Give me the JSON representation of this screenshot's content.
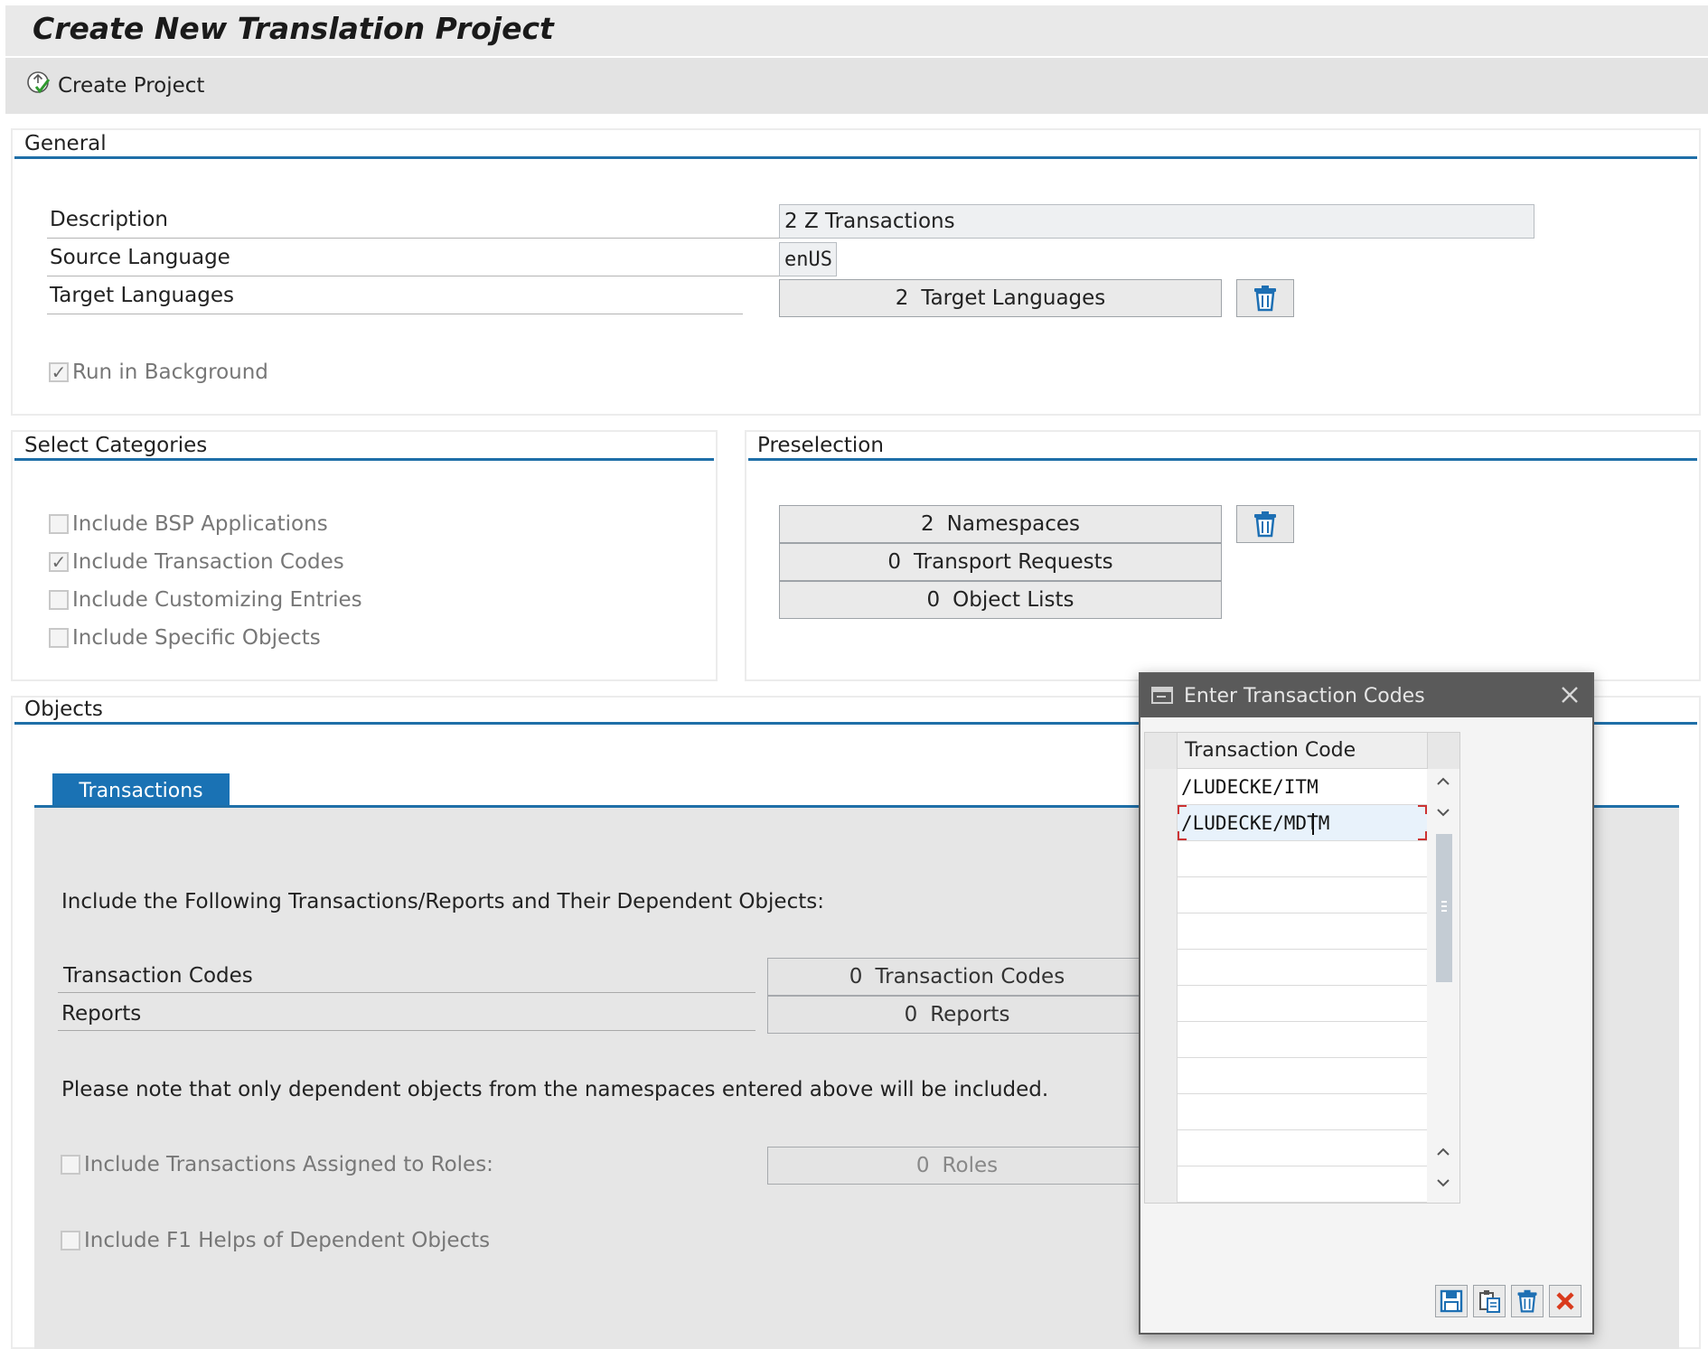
{
  "page": {
    "title": "Create New Translation Project"
  },
  "toolbar": {
    "create_project": "Create Project",
    "create_icon": "create-project-icon"
  },
  "general": {
    "heading": "General",
    "description_label": "Description",
    "description_value": "2 Z Transactions",
    "source_language_label": "Source Language",
    "source_language_value": "enUS",
    "target_languages_label": "Target Languages",
    "target_languages_count": "2",
    "target_languages_text": "Target Languages",
    "run_in_background": "Run in Background"
  },
  "categories": {
    "heading": "Select Categories",
    "items": [
      {
        "label": "Include BSP Applications",
        "checked": false
      },
      {
        "label": "Include Transaction Codes",
        "checked": true
      },
      {
        "label": "Include Customizing Entries",
        "checked": false
      },
      {
        "label": "Include Specific Objects",
        "checked": false
      }
    ]
  },
  "preselection": {
    "heading": "Preselection",
    "namespaces_count": "2",
    "namespaces_text": "Namespaces",
    "transport_count": "0",
    "transport_text": "Transport Requests",
    "objectlists_count": "0",
    "objectlists_text": "Object Lists"
  },
  "objects": {
    "heading": "Objects",
    "tab_transactions": "Transactions",
    "intro": "Include the Following Transactions/Reports and Their Dependent Objects:",
    "tcodes_label": "Transaction Codes",
    "tcodes_count": "0",
    "tcodes_text": "Transaction Codes",
    "reports_label": "Reports",
    "reports_count": "0",
    "reports_text": "Reports",
    "note": "Please note that only dependent objects from the namespaces entered above will be included.",
    "roles_label": "Include Transactions Assigned to Roles:",
    "roles_count": "0",
    "roles_text": "Roles",
    "f1_label": "Include F1 Helps of Dependent Objects"
  },
  "dialog": {
    "title": "Enter Transaction Codes",
    "column_header": "Transaction Code",
    "rows": [
      "/LUDECKE/ITM",
      "/LUDECKE/MDTM",
      "",
      "",
      "",
      "",
      "",
      "",
      "",
      "",
      "",
      ""
    ]
  }
}
